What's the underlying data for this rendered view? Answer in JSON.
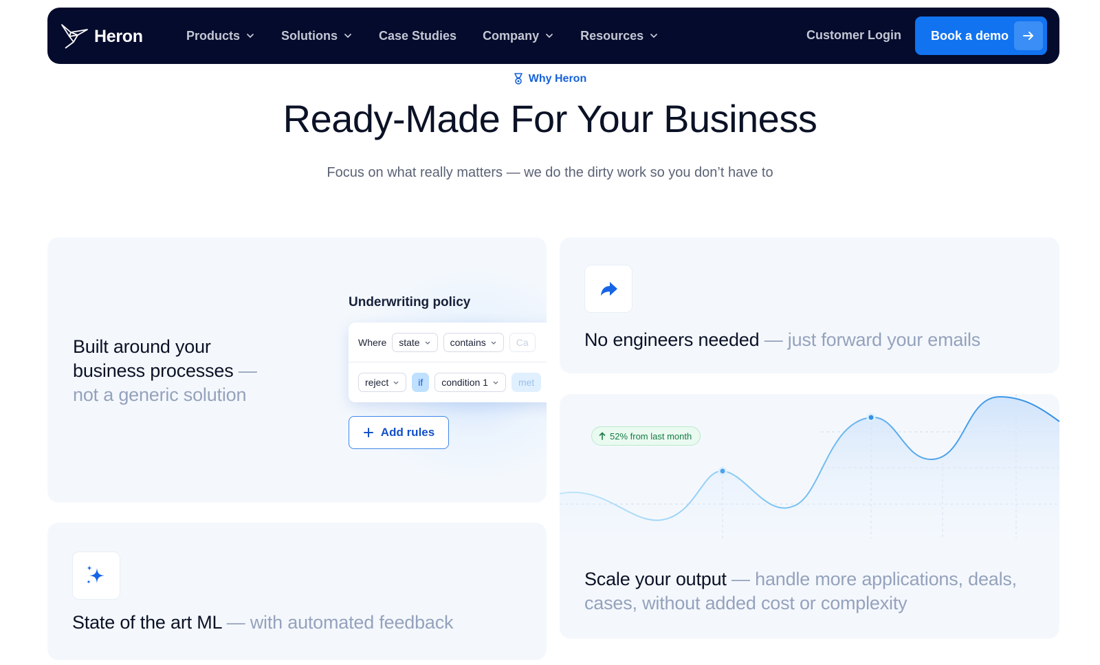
{
  "nav": {
    "brand": "Heron",
    "items": [
      {
        "label": "Products",
        "dropdown": true
      },
      {
        "label": "Solutions",
        "dropdown": true
      },
      {
        "label": "Case Studies",
        "dropdown": false
      },
      {
        "label": "Company",
        "dropdown": true
      },
      {
        "label": "Resources",
        "dropdown": true
      }
    ],
    "login": "Customer Login",
    "cta": "Book a demo"
  },
  "hero": {
    "eyebrow": "Why Heron",
    "title": "Ready-Made For Your Business",
    "subtitle": "Focus on what really matters — we do the dirty work so you don’t have to"
  },
  "cards": {
    "processes": {
      "lead": "Built around your business processes",
      "muted": " — not a generic solution",
      "policy": {
        "title": "Underwriting policy",
        "row1": {
          "where": "Where",
          "field": "state",
          "op": "contains",
          "value": "Ca"
        },
        "row2": {
          "action": "reject",
          "if": "if",
          "condition": "condition 1",
          "next": "met"
        },
        "add": "Add rules"
      }
    },
    "engineers": {
      "lead": "No engineers needed",
      "muted": " — just forward your emails",
      "icon": "forward-arrow-icon"
    },
    "ml": {
      "lead": "State of the art ML",
      "muted": " — with automated feedback",
      "icon": "sparkle-icon"
    },
    "scale": {
      "lead": "Scale your output",
      "muted": " — handle more applications, deals, cases, without added cost or complexity",
      "badge": "52% from last month"
    }
  },
  "colors": {
    "nav_bg": "#050b2c",
    "cta": "#1173f0",
    "accent": "#1662d9",
    "card_bg": "#f4f8fd",
    "muted_text": "#95a2bc"
  }
}
